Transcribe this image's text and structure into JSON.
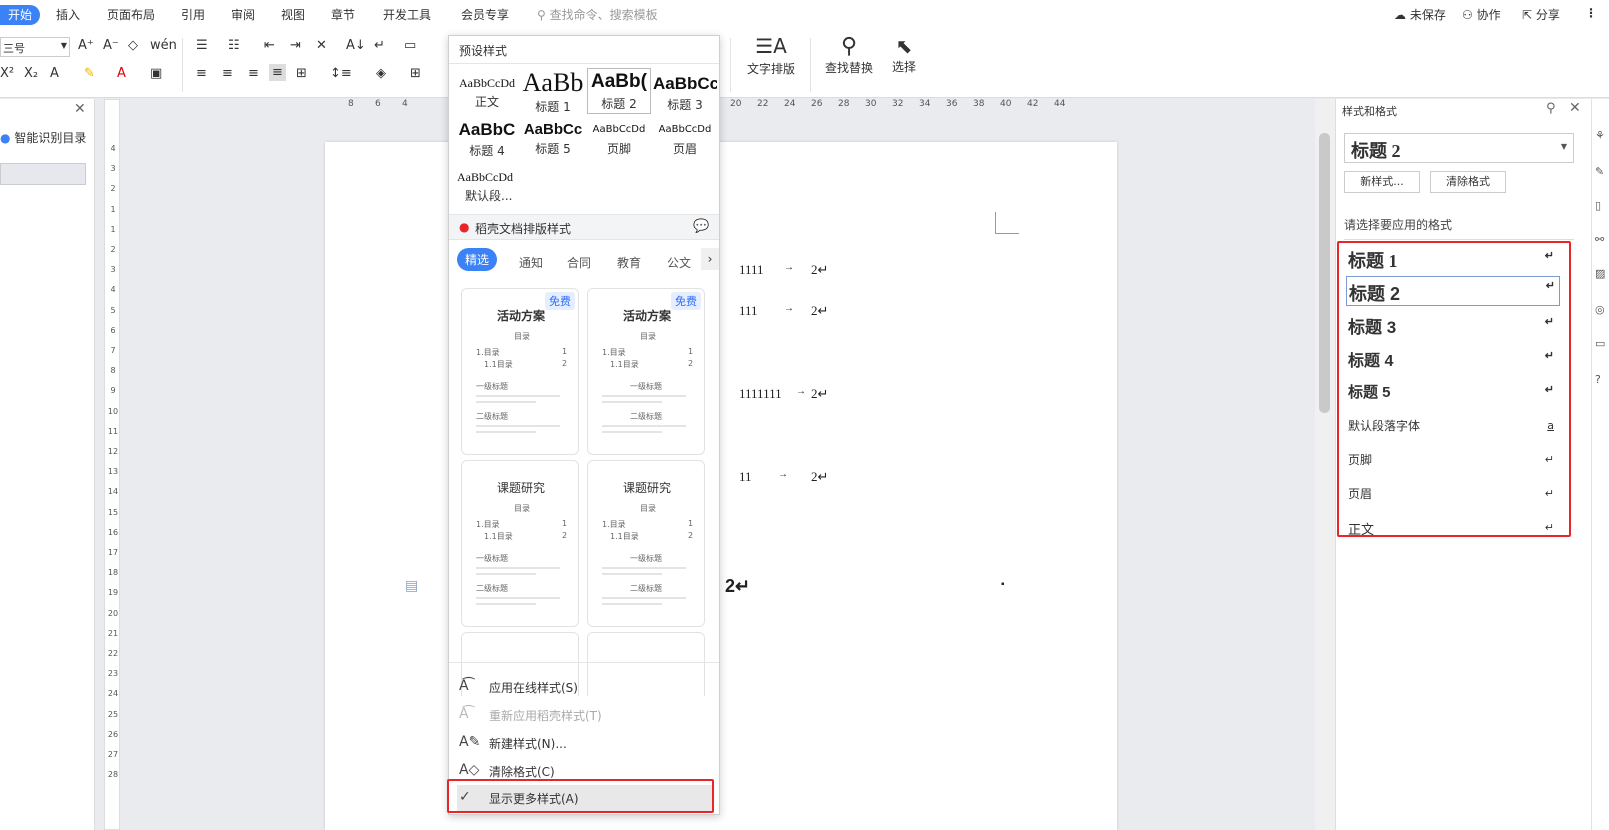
{
  "menubar": {
    "start": "开始",
    "items": [
      "插入",
      "页面布局",
      "引用",
      "审阅",
      "视图",
      "章节",
      "开发工具",
      "会员专享"
    ],
    "search": "查找命令、搜索模板",
    "unsaved": "未保存",
    "collab": "协作",
    "share": "分享"
  },
  "ribbon": {
    "font_size": "三号",
    "text_layout": "文字排版",
    "find_replace": "查找替换",
    "select": "选择"
  },
  "left_panel": {
    "smart_toc": "智能识别目录"
  },
  "hruler": [
    "8",
    "6",
    "4",
    "20",
    "22",
    "24",
    "26",
    "28",
    "30",
    "32",
    "34",
    "36",
    "38",
    "40",
    "42",
    "44"
  ],
  "vruler": [
    "4",
    "3",
    "2",
    "1",
    "1",
    "2",
    "3",
    "4",
    "5",
    "6",
    "7",
    "8",
    "9",
    "10",
    "11",
    "12",
    "13",
    "14",
    "15",
    "16",
    "17",
    "18",
    "19",
    "20",
    "21",
    "22",
    "23",
    "24",
    "25",
    "26",
    "27",
    "28"
  ],
  "document": {
    "lines": [
      {
        "text": "1111",
        "page": "2↵"
      },
      {
        "text": "111",
        "page": "2↵"
      },
      {
        "text": "1111111",
        "page": "2↵"
      },
      {
        "text": "11",
        "page": "2↵"
      }
    ],
    "arrow": "→",
    "bold_two": "2↵",
    "dot": "▪",
    "bottom_mark": "↵"
  },
  "dropdown": {
    "preset_title": "预设样式",
    "presets": [
      {
        "sample": "AaBbCcDd",
        "name": "正文"
      },
      {
        "sample": "AaBb",
        "name": "标题 1"
      },
      {
        "sample": "AaBb(",
        "name": "标题 2"
      },
      {
        "sample": "AaBbCc",
        "name": "标题 3"
      },
      {
        "sample": "AaBbC",
        "name": "标题 4"
      },
      {
        "sample": "AaBbCc",
        "name": "标题 5"
      },
      {
        "sample": "AaBbCcDd",
        "name": "页脚"
      },
      {
        "sample": "AaBbCcDd",
        "name": "页眉"
      },
      {
        "sample": "AaBbCcDd",
        "name": "默认段..."
      }
    ],
    "docer_title": "稻壳文档排版样式",
    "categories": [
      "精选",
      "通知",
      "合同",
      "教育",
      "公文"
    ],
    "templates": [
      {
        "title": "活动方案",
        "badge": "免费",
        "toc": "目录",
        "l1": "1.目录",
        "l2": "1.1目录",
        "h1": "一级标题",
        "h2": "二级标题",
        "n1": "1",
        "n2": "2"
      },
      {
        "title": "活动方案",
        "badge": "免费",
        "toc": "目录",
        "l1": "1.目录",
        "l2": "1.1目录",
        "h1": "一级标题",
        "h2": "二级标题",
        "n1": "1",
        "n2": "2"
      },
      {
        "title": "课题研究",
        "toc": "目录",
        "l1": "1.目录",
        "l2": "1.1目录",
        "h1": "一级标题",
        "h2": "二级标题",
        "n1": "1",
        "n2": "2"
      },
      {
        "title": "课题研究",
        "toc": "目录",
        "l1": "1.目录",
        "l2": "1.1目录",
        "h1": "一级标题",
        "h2": "二级标题",
        "n1": "1",
        "n2": "2"
      }
    ],
    "actions": [
      {
        "label": "应用在线样式(S)",
        "enabled": true
      },
      {
        "label": "重新应用稻壳样式(T)",
        "enabled": false
      },
      {
        "label": "新建样式(N)...",
        "enabled": true
      },
      {
        "label": "清除格式(C)",
        "enabled": true
      },
      {
        "label": "显示更多样式(A)",
        "enabled": true,
        "checked": true
      }
    ]
  },
  "right_panel": {
    "title": "样式和格式",
    "current_style": "标题 2",
    "new_style": "新样式...",
    "clear_format": "清除格式",
    "prompt": "请选择要应用的格式",
    "styles": [
      {
        "name": "标题 1",
        "mark": "↵"
      },
      {
        "name": "标题 2",
        "mark": "↵"
      },
      {
        "name": "标题 3",
        "mark": "↵"
      },
      {
        "name": "标题 4",
        "mark": "↵"
      },
      {
        "name": "标题 5",
        "mark": "↵"
      },
      {
        "name": "默认段落字体",
        "mark": "a"
      },
      {
        "name": "页脚",
        "mark": "↵"
      },
      {
        "name": "页眉",
        "mark": "↵"
      },
      {
        "name": "正文",
        "mark": "↵"
      }
    ]
  },
  "colors": {
    "accent": "#3b82f6",
    "highlight": "#e8262a"
  }
}
